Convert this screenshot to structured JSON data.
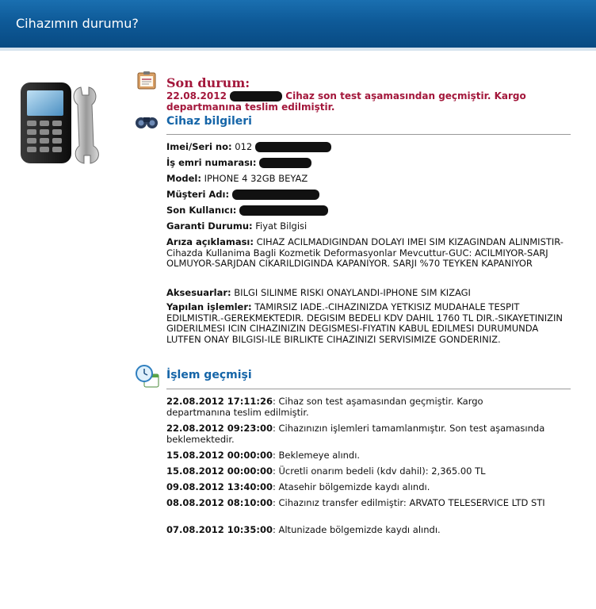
{
  "window": {
    "title": "Cihazımın durumu?"
  },
  "son_durum": {
    "title": "Son durum:",
    "date": "22.08.2012",
    "message": "Cihaz son test aşamasından geçmiştir. Kargo departmanına teslim edilmiştir."
  },
  "cihaz_bilgileri": {
    "title": "Cihaz bilgileri",
    "fields": [
      {
        "label": "Imei/Seri no:",
        "value": "012"
      },
      {
        "label": "İş emri numarası:",
        "value": ""
      },
      {
        "label": "Model:",
        "value": "IPHONE 4 32GB BEYAZ"
      },
      {
        "label": "Müşteri Adı:",
        "value": ""
      },
      {
        "label": "Son Kullanıcı:",
        "value": ""
      },
      {
        "label": "Garanti Durumu:",
        "value": "Fiyat Bilgisi"
      },
      {
        "label": "Arıza açıklaması:",
        "value": "CIHAZ ACILMADIGINDAN DOLAYI IMEI SIM KIZAGINDAN ALINMISTIR-Cihazda Kullanima Bagli Kozmetik Deformasyonlar Mevcuttur-GUC: ACILMIYOR-SARJ OLMUYOR-SARJDAN CIKARILDIGINDA KAPANIYOR. SARJI %70 TEYKEN KAPANIYOR"
      },
      {
        "label": "Aksesuarlar:",
        "value": "BILGI SILINME RISKI ONAYLANDI-IPHONE SIM KIZAGI"
      },
      {
        "label": "Yapılan işlemler:",
        "value": "TAMIRSIZ IADE.-CIHAZINIZDA YETKISIZ MUDAHALE TESPIT EDILMISTIR.-GEREKMEKTEDIR. DEGISIM BEDELI KDV DAHIL 1760 TL DIR.-SIKAYETINIZIN GIDERILMESI ICIN CIHAZINIZIN DEGISMESI-FIYATIN KABUL EDILMESI DURUMUNDA LUTFEN ONAY BILGISI-ILE BIRLIKTE CIHAZINIZI SERVISIMIZE GONDERINIZ."
      }
    ]
  },
  "islem_gecmisi": {
    "title": "İşlem geçmişi",
    "entries": [
      {
        "datetime": "22.08.2012 17:11:26",
        "text": ": Cihaz son test aşamasından geçmiştir. Kargo departmanına teslim edilmiştir."
      },
      {
        "datetime": "22.08.2012 09:23:00",
        "text": ": Cihazınızın işlemleri tamamlanmıştır. Son test aşamasında beklemektedir."
      },
      {
        "datetime": "15.08.2012 00:00:00",
        "text": ": Beklemeye alındı."
      },
      {
        "datetime": "15.08.2012 00:00:00",
        "text": ": Ücretli onarım bedeli (kdv dahil): 2,365.00 TL"
      },
      {
        "datetime": "09.08.2012 13:40:00",
        "text": ": Atasehir bölgemizde kaydı alındı."
      },
      {
        "datetime": "08.08.2012 08:10:00",
        "text": ": Cihazınız transfer edilmiştir: ARVATO TELESERVICE LTD STI"
      },
      {
        "datetime": "07.08.2012 10:35:00",
        "text": ": Altunizade bölgemizde kaydı alındı."
      }
    ]
  },
  "icons": {
    "device": "phone-wrench-icon",
    "status": "clipboard-icon",
    "info": "binoculars-icon",
    "history": "clock-calendar-icon"
  },
  "colors": {
    "accent_red": "#a3173b",
    "section_blue": "#1565a8",
    "titlebar": "#0e5a98"
  }
}
